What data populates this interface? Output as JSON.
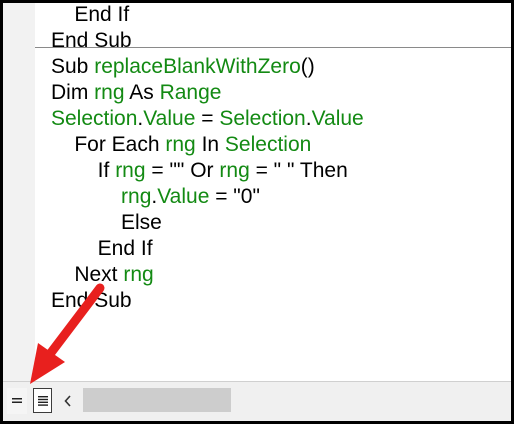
{
  "code_lines": [
    [
      {
        "t": "    End If",
        "c": "kw"
      }
    ],
    [
      {
        "t": "End Sub",
        "c": "kw"
      }
    ],
    [
      {
        "t": "Sub ",
        "c": "kw"
      },
      {
        "t": "replaceBlankWithZero",
        "c": "id"
      },
      {
        "t": "()",
        "c": "kw"
      }
    ],
    [
      {
        "t": "Dim ",
        "c": "kw"
      },
      {
        "t": "rng",
        "c": "id"
      },
      {
        "t": " As ",
        "c": "kw"
      },
      {
        "t": "Range",
        "c": "id"
      }
    ],
    [
      {
        "t": "Selection",
        "c": "id"
      },
      {
        "t": ".",
        "c": "kw"
      },
      {
        "t": "Value",
        "c": "id"
      },
      {
        "t": " = ",
        "c": "kw"
      },
      {
        "t": "Selection",
        "c": "id"
      },
      {
        "t": ".",
        "c": "kw"
      },
      {
        "t": "Value",
        "c": "id"
      }
    ],
    [
      {
        "t": "    For Each ",
        "c": "kw"
      },
      {
        "t": "rng",
        "c": "id"
      },
      {
        "t": " In ",
        "c": "kw"
      },
      {
        "t": "Selection",
        "c": "id"
      }
    ],
    [
      {
        "t": "        If ",
        "c": "kw"
      },
      {
        "t": "rng",
        "c": "id"
      },
      {
        "t": " = \"\" Or ",
        "c": "kw"
      },
      {
        "t": "rng",
        "c": "id"
      },
      {
        "t": " = \" \" Then",
        "c": "kw"
      }
    ],
    [
      {
        "t": "            ",
        "c": "kw"
      },
      {
        "t": "rng",
        "c": "id"
      },
      {
        "t": ".",
        "c": "kw"
      },
      {
        "t": "Value",
        "c": "id"
      },
      {
        "t": " = \"0\"",
        "c": "kw"
      }
    ],
    [
      {
        "t": "            Else",
        "c": "kw"
      }
    ],
    [
      {
        "t": "        End If",
        "c": "kw"
      }
    ],
    [
      {
        "t": "    Next ",
        "c": "kw"
      },
      {
        "t": "rng",
        "c": "id"
      }
    ],
    [
      {
        "t": "End Sub",
        "c": "kw"
      }
    ]
  ],
  "icons": {
    "procedure_view": "procedure-view-icon",
    "full_module_view": "full-module-view-icon",
    "scroll_left": "chevron-left-icon",
    "annotation": "red-arrow"
  },
  "colors": {
    "keyword": "#000000",
    "identifier": "#138a13",
    "arrow": "#e8201e"
  }
}
